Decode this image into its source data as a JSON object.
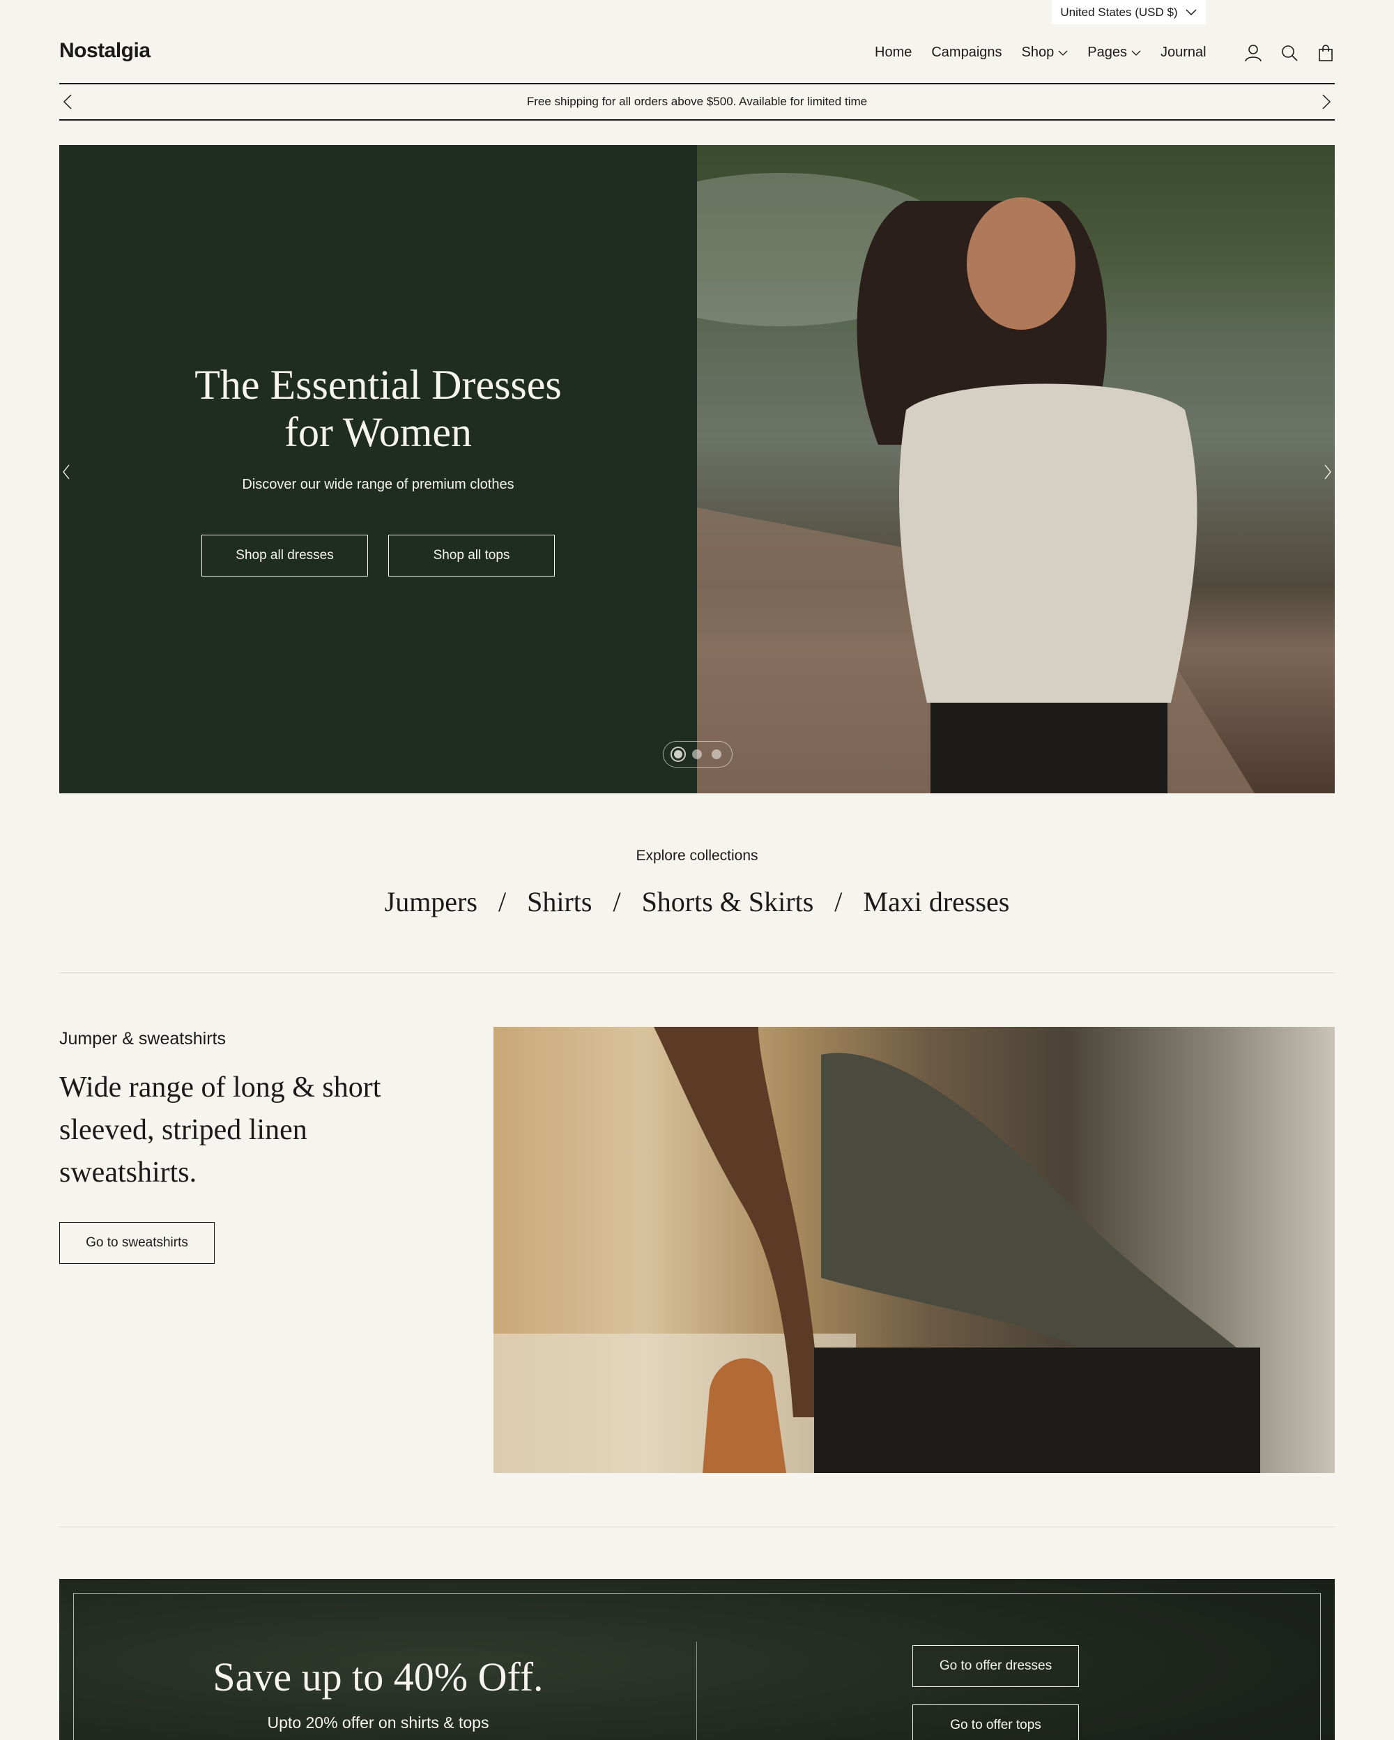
{
  "currency": {
    "label": "United States (USD $)"
  },
  "header": {
    "logo": "Nostalgia",
    "nav": [
      {
        "label": "Home"
      },
      {
        "label": "Campaigns"
      },
      {
        "label": "Shop"
      },
      {
        "label": "Pages"
      },
      {
        "label": "Journal"
      }
    ],
    "icons": [
      "account-icon",
      "search-icon",
      "cart-icon"
    ]
  },
  "announcement": {
    "text": "Free shipping for all orders above $500. Available for limited time"
  },
  "hero": {
    "title_line1": "The Essential Dresses",
    "title_line2": "for Women",
    "subtitle": "Discover our wide range of premium clothes",
    "button_dresses": "Shop all dresses",
    "button_tops": "Shop all tops",
    "slides_total": 3,
    "slide_active": 1
  },
  "collections": {
    "heading": "Explore collections",
    "items": [
      "Jumpers",
      "Shirts",
      "Shorts & Skirts",
      "Maxi dresses"
    ],
    "separator": "/"
  },
  "feature": {
    "kicker": "Jumper & sweatshirts",
    "title": "Wide range of long & short sleeved, striped linen sweatshirts.",
    "button": "Go to sweatshirts"
  },
  "offer": {
    "title": "Save up to 40% Off.",
    "subtitle": "Upto 20% offer on shirts & tops",
    "button_dresses": "Go to offer dresses",
    "button_tops": "Go to offer tops"
  },
  "colors": {
    "background": "#f6f4ee",
    "hero_panel": "#1f2c21",
    "text": "#1a1a1a"
  }
}
